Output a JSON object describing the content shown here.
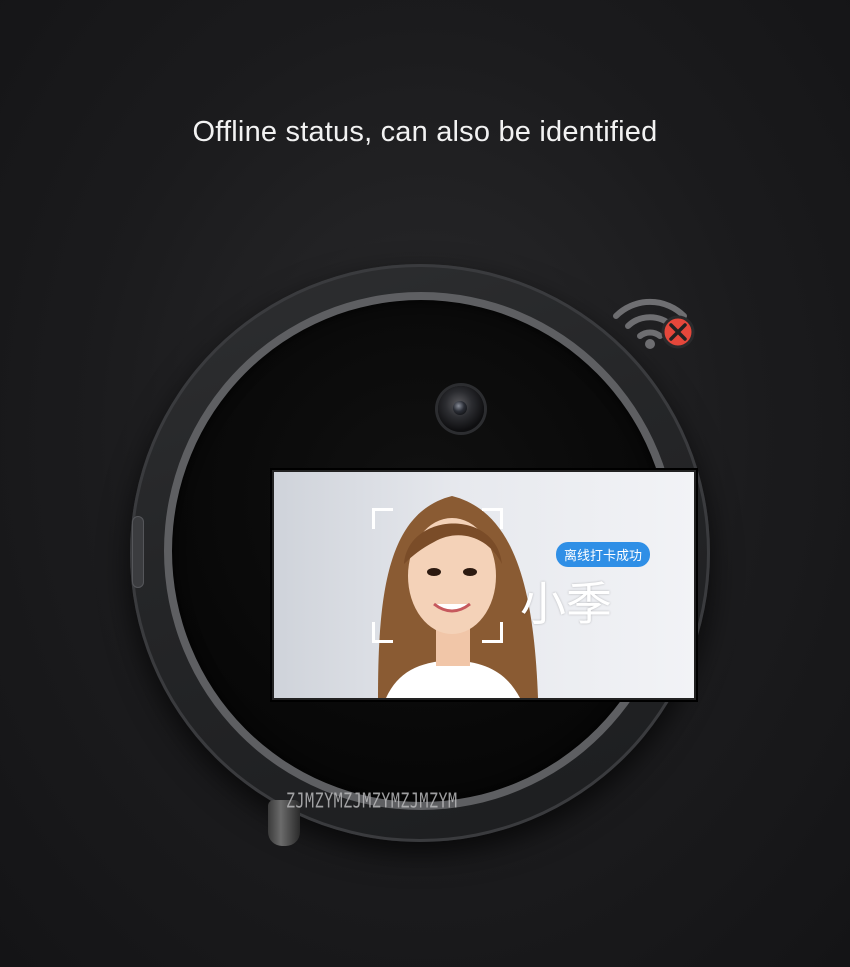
{
  "headline": "Offline status, can also be identified",
  "wifi_status": {
    "icon": "wifi-off-icon",
    "indicator_color": "#e5473b"
  },
  "screen": {
    "badge_text": "离线打卡成功",
    "name_text": "小季",
    "badge_color": "#2f8fe6"
  },
  "watermark": "ZJMZYMZJMZYMZJMZYM"
}
